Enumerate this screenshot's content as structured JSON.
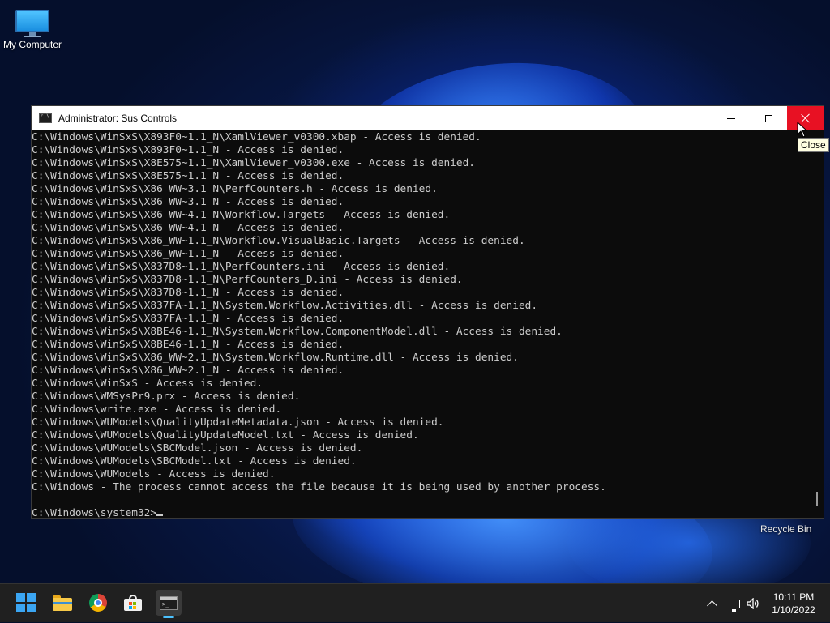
{
  "desktop": {
    "icons": [
      {
        "label": "My Computer"
      },
      {
        "label": "Recycle Bin"
      }
    ]
  },
  "window": {
    "title": "Administrator: Sus Controls",
    "close_tooltip": "Close",
    "lines": [
      "C:\\Windows\\WinSxS\\X893F0~1.1_N\\XamlViewer_v0300.xbap - Access is denied.",
      "C:\\Windows\\WinSxS\\X893F0~1.1_N - Access is denied.",
      "C:\\Windows\\WinSxS\\X8E575~1.1_N\\XamlViewer_v0300.exe - Access is denied.",
      "C:\\Windows\\WinSxS\\X8E575~1.1_N - Access is denied.",
      "C:\\Windows\\WinSxS\\X86_WW~3.1_N\\PerfCounters.h - Access is denied.",
      "C:\\Windows\\WinSxS\\X86_WW~3.1_N - Access is denied.",
      "C:\\Windows\\WinSxS\\X86_WW~4.1_N\\Workflow.Targets - Access is denied.",
      "C:\\Windows\\WinSxS\\X86_WW~4.1_N - Access is denied.",
      "C:\\Windows\\WinSxS\\X86_WW~1.1_N\\Workflow.VisualBasic.Targets - Access is denied.",
      "C:\\Windows\\WinSxS\\X86_WW~1.1_N - Access is denied.",
      "C:\\Windows\\WinSxS\\X837D8~1.1_N\\PerfCounters.ini - Access is denied.",
      "C:\\Windows\\WinSxS\\X837D8~1.1_N\\PerfCounters_D.ini - Access is denied.",
      "C:\\Windows\\WinSxS\\X837D8~1.1_N - Access is denied.",
      "C:\\Windows\\WinSxS\\X837FA~1.1_N\\System.Workflow.Activities.dll - Access is denied.",
      "C:\\Windows\\WinSxS\\X837FA~1.1_N - Access is denied.",
      "C:\\Windows\\WinSxS\\X8BE46~1.1_N\\System.Workflow.ComponentModel.dll - Access is denied.",
      "C:\\Windows\\WinSxS\\X8BE46~1.1_N - Access is denied.",
      "C:\\Windows\\WinSxS\\X86_WW~2.1_N\\System.Workflow.Runtime.dll - Access is denied.",
      "C:\\Windows\\WinSxS\\X86_WW~2.1_N - Access is denied.",
      "C:\\Windows\\WinSxS - Access is denied.",
      "C:\\Windows\\WMSysPr9.prx - Access is denied.",
      "C:\\Windows\\write.exe - Access is denied.",
      "C:\\Windows\\WUModels\\QualityUpdateMetadata.json - Access is denied.",
      "C:\\Windows\\WUModels\\QualityUpdateModel.txt - Access is denied.",
      "C:\\Windows\\WUModels\\SBCModel.json - Access is denied.",
      "C:\\Windows\\WUModels\\SBCModel.txt - Access is denied.",
      "C:\\Windows\\WUModels - Access is denied.",
      "C:\\Windows - The process cannot access the file because it is being used by another process.",
      ""
    ],
    "prompt": "C:\\Windows\\system32>"
  },
  "taskbar": {
    "apps": [
      {
        "icon": "windows-start-icon"
      },
      {
        "icon": "file-explorer-icon"
      },
      {
        "icon": "chrome-icon"
      },
      {
        "icon": "microsoft-store-icon"
      },
      {
        "icon": "command-prompt-icon",
        "active": true
      }
    ],
    "clock": {
      "time": "10:11 PM",
      "date": "1/10/2022"
    }
  },
  "colors": {
    "console_bg": "#0c0c0c",
    "console_text": "#cccccc",
    "close_hover": "#e81123",
    "taskbar_bg": "#202020",
    "accent": "#4cc2ff"
  }
}
